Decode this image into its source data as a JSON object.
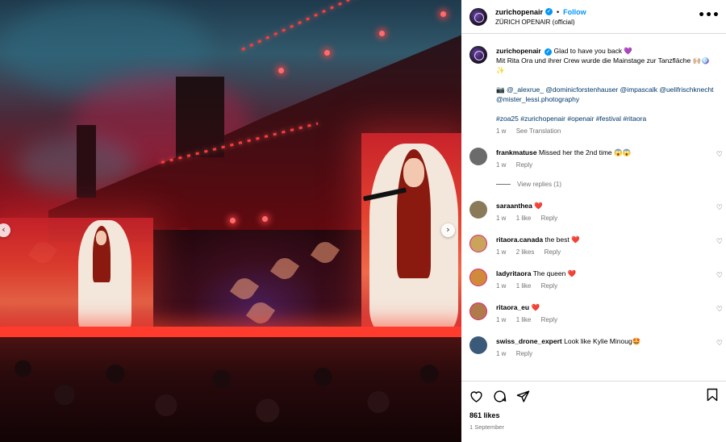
{
  "post": {
    "username": "zurichopenair",
    "follow_label": "Follow",
    "bullet": "•",
    "subtitle": "ZÜRICH OPENAIR (official)",
    "more_label": "•••"
  },
  "caption": {
    "username": "zurichopenair",
    "line1": "Glad to have you back 💜",
    "line2": "Mit Rita Ora und ihrer Crew wurde die Mainstage zur Tanzfläche 🙌🏼🪩✨",
    "credits_prefix": "📷",
    "credits": "@_alexrue_ @dominicforstenhauser @impascalk @uelifrischknecht @mister_lessi.photography",
    "hashtags": "#zoa25 #zurichopenair #openair #festival #ritaora",
    "time": "1 w",
    "see_translation": "See Translation"
  },
  "comments": [
    {
      "username": "frankmatuse",
      "text": "Missed her the 2nd time 😱😱",
      "time": "1 w",
      "likes": "",
      "reply": "Reply",
      "view_replies": "View replies (1)",
      "avatar_color": "#6b6b6b"
    },
    {
      "username": "saraanthea",
      "text": "❤️",
      "time": "1 w",
      "likes": "1 like",
      "reply": "Reply",
      "avatar_color": "#8a7a5a"
    },
    {
      "username": "ritaora.canada",
      "text": "the best ❤️",
      "time": "1 w",
      "likes": "2 likes",
      "reply": "Reply",
      "avatar_color": "#c9a45a"
    },
    {
      "username": "ladyritaora",
      "text": "The queen ❤️",
      "time": "1 w",
      "likes": "1 like",
      "reply": "Reply",
      "avatar_color": "#d18a3a"
    },
    {
      "username": "ritaora_eu",
      "text": "❤️",
      "time": "1 w",
      "likes": "1 like",
      "reply": "Reply",
      "avatar_color": "#b07a4a"
    },
    {
      "username": "swiss_drone_expert",
      "text": "Look like Kylie Minoug🤩",
      "time": "1 w",
      "likes": "",
      "reply": "Reply",
      "avatar_color": "#3b5a7a"
    }
  ],
  "stats": {
    "likes": "861 likes",
    "date": "1 September"
  },
  "icons": {
    "like": "heart-icon",
    "comment": "comment-icon",
    "share": "share-icon",
    "save": "bookmark-icon",
    "verified": "verified-badge-icon",
    "prev": "chevron-left-icon",
    "next": "chevron-right-icon"
  },
  "colors": {
    "link": "#0095f6",
    "mention": "#00376b",
    "muted": "#737373",
    "border": "#dbdbdb"
  }
}
